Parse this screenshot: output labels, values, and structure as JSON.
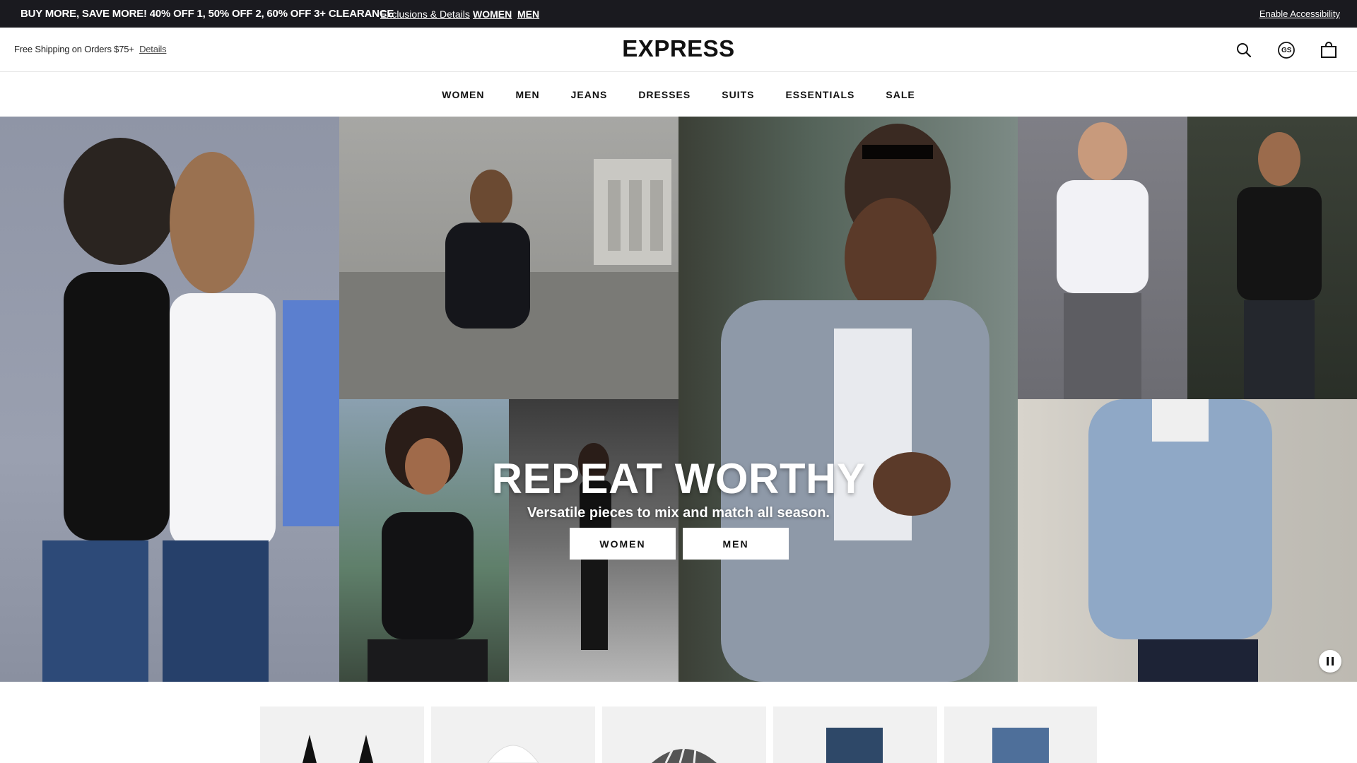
{
  "promo": {
    "text": "BUY MORE, SAVE MORE! 40% OFF 1, 50% OFF 2, 60% OFF 3+ CLEARANCE",
    "link_details": "Exclusions & Details",
    "link_women": "WOMEN",
    "link_men": "MEN",
    "accessibility": "Enable Accessibility"
  },
  "header": {
    "shipping_text": "Free Shipping on Orders $75+",
    "shipping_link": "Details",
    "logo": "EXPRESS",
    "icons": [
      "search-icon",
      "gift-card-icon",
      "shopping-bag-icon"
    ],
    "gs_label": "GS"
  },
  "nav": {
    "items": [
      "WOMEN",
      "MEN",
      "JEANS",
      "DRESSES",
      "SUITS",
      "ESSENTIALS",
      "SALE"
    ]
  },
  "hero": {
    "title": "REPEAT WORTHY",
    "subtitle": "Versatile pieces to mix and match all season.",
    "buttons": [
      "WOMEN",
      "MEN"
    ],
    "pause_icon": "pause-icon"
  },
  "colors": {
    "promo_bg": "#1a1a1f",
    "text": "#111111",
    "white": "#ffffff"
  }
}
